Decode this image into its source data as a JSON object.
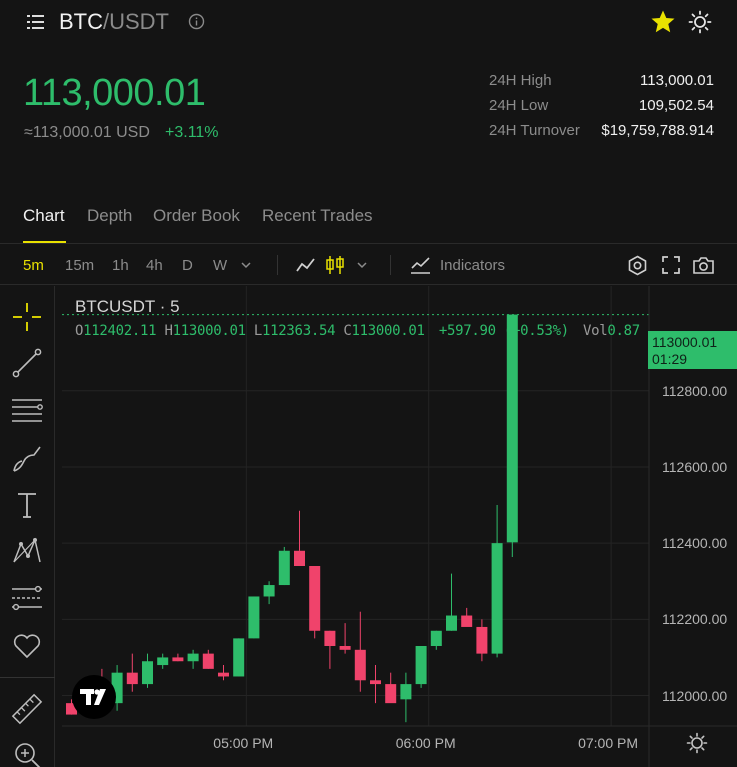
{
  "header": {
    "base": "BTC",
    "quote": "/USDT"
  },
  "ticker": {
    "last_price": "113,000.01",
    "usd_equiv": "≈113,000.01 USD",
    "change_pct": "+3.11%",
    "stats": [
      {
        "label": "24H High",
        "value": "113,000.01"
      },
      {
        "label": "24H Low",
        "value": "109,502.54"
      },
      {
        "label": "24H Turnover",
        "value": "$19,759,788.914"
      }
    ]
  },
  "tabs": [
    {
      "label": "Chart",
      "active": true
    },
    {
      "label": "Depth",
      "active": false
    },
    {
      "label": "Order Book",
      "active": false
    },
    {
      "label": "Recent Trades",
      "active": false
    }
  ],
  "toolbar": {
    "timeframes": [
      "5m",
      "15m",
      "1h",
      "4h",
      "D",
      "W"
    ],
    "active_timeframe": "5m",
    "indicators_label": "Indicators"
  },
  "chart_legend": {
    "title": "BTCUSDT · 5",
    "o_label": "O",
    "o": "112402.11",
    "h_label": "H",
    "h": "113000.01",
    "l_label": "L",
    "l": "112363.54",
    "c_label": "C",
    "c": "113000.01",
    "change": "+597.90 (+0.53%)",
    "vol_label": "Vol",
    "vol": "0.87"
  },
  "price_tag": {
    "price": "113000.01",
    "countdown": "01:29"
  },
  "colors": {
    "up": "#2ebd6b",
    "down": "#f0436b",
    "accent": "#e9e100",
    "background": "#141414"
  },
  "chart_data": {
    "type": "candlestick",
    "symbol": "BTCUSDT",
    "interval": "5",
    "x_ticks": [
      "05:00 PM",
      "06:00 PM",
      "07:00 PM"
    ],
    "y_ticks": [
      "112800.00",
      "112600.00",
      "112400.00",
      "112200.00",
      "112000.00"
    ],
    "ylim": [
      111920,
      113075
    ],
    "last_price": 113000.01,
    "candles": [
      {
        "o": 111980,
        "h": 111990,
        "l": 111950,
        "c": 111950
      },
      {
        "o": 111960,
        "h": 112030,
        "l": 111950,
        "c": 112020
      },
      {
        "o": 112030,
        "h": 112070,
        "l": 111960,
        "c": 111980
      },
      {
        "o": 111980,
        "h": 112080,
        "l": 111960,
        "c": 112060
      },
      {
        "o": 112060,
        "h": 112110,
        "l": 112010,
        "c": 112030
      },
      {
        "o": 112030,
        "h": 112110,
        "l": 112020,
        "c": 112090
      },
      {
        "o": 112080,
        "h": 112110,
        "l": 112070,
        "c": 112100
      },
      {
        "o": 112100,
        "h": 112110,
        "l": 112090,
        "c": 112090
      },
      {
        "o": 112090,
        "h": 112120,
        "l": 112070,
        "c": 112110
      },
      {
        "o": 112110,
        "h": 112120,
        "l": 112070,
        "c": 112070
      },
      {
        "o": 112060,
        "h": 112080,
        "l": 112040,
        "c": 112050
      },
      {
        "o": 112050,
        "h": 112150,
        "l": 112050,
        "c": 112150
      },
      {
        "o": 112150,
        "h": 112260,
        "l": 112150,
        "c": 112260
      },
      {
        "o": 112260,
        "h": 112300,
        "l": 112240,
        "c": 112290
      },
      {
        "o": 112290,
        "h": 112390,
        "l": 112290,
        "c": 112380
      },
      {
        "o": 112380,
        "h": 112485,
        "l": 112380,
        "c": 112340
      },
      {
        "o": 112340,
        "h": 112340,
        "l": 112150,
        "c": 112170
      },
      {
        "o": 112170,
        "h": 112170,
        "l": 112070,
        "c": 112130
      },
      {
        "o": 112130,
        "h": 112190,
        "l": 112110,
        "c": 112120
      },
      {
        "o": 112120,
        "h": 112220,
        "l": 112010,
        "c": 112040
      },
      {
        "o": 112040,
        "h": 112080,
        "l": 111980,
        "c": 112030
      },
      {
        "o": 112030,
        "h": 112060,
        "l": 111990,
        "c": 111980
      },
      {
        "o": 111990,
        "h": 112060,
        "l": 111930,
        "c": 112030
      },
      {
        "o": 112030,
        "h": 112130,
        "l": 112020,
        "c": 112130
      },
      {
        "o": 112130,
        "h": 112170,
        "l": 112120,
        "c": 112170
      },
      {
        "o": 112170,
        "h": 112320,
        "l": 112170,
        "c": 112210
      },
      {
        "o": 112210,
        "h": 112230,
        "l": 112190,
        "c": 112180
      },
      {
        "o": 112180,
        "h": 112200,
        "l": 112090,
        "c": 112110
      },
      {
        "o": 112110,
        "h": 112500,
        "l": 112100,
        "c": 112400
      },
      {
        "o": 112402.11,
        "h": 113000.01,
        "l": 112363.54,
        "c": 113000.01
      }
    ],
    "last_candle_volume": 0.87
  }
}
